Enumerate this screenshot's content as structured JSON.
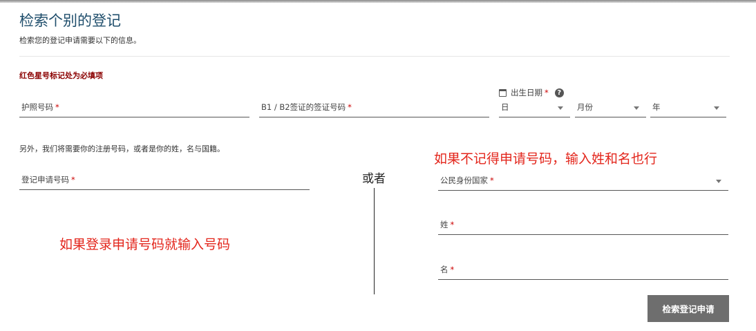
{
  "header": {
    "title": "检索个别的登记",
    "subtitle": "检索您的登记申请需要以下的信息。"
  },
  "required_note": "红色星号标记处为必填项",
  "required_mark": "*",
  "fields": {
    "passport": {
      "label": "护照号码"
    },
    "visa": {
      "label": "B1 / B2签证的签证号码"
    },
    "dob": {
      "label": "出生日期",
      "help_icon": "?",
      "day_placeholder": "日",
      "month_placeholder": "月份",
      "year_placeholder": "年"
    },
    "application_number": {
      "label": "登记申请号码"
    },
    "citizenship": {
      "label": "公民身份国家"
    },
    "last_name": {
      "label": "姓"
    },
    "first_name": {
      "label": "名"
    }
  },
  "info_text": "另外，我们将需要你的注册号码，或者是你的姓，名与国籍。",
  "or_label": "或者",
  "annotations": {
    "left": "如果登录申请号码就输入号码",
    "right": "如果不记得申请号码，输入姓和名也行"
  },
  "submit_label": "检索登记申请",
  "colors": {
    "title": "#1e4d6b",
    "required_note": "#8b0000",
    "annotation": "#e3261c",
    "button": "#6e6e6e"
  }
}
